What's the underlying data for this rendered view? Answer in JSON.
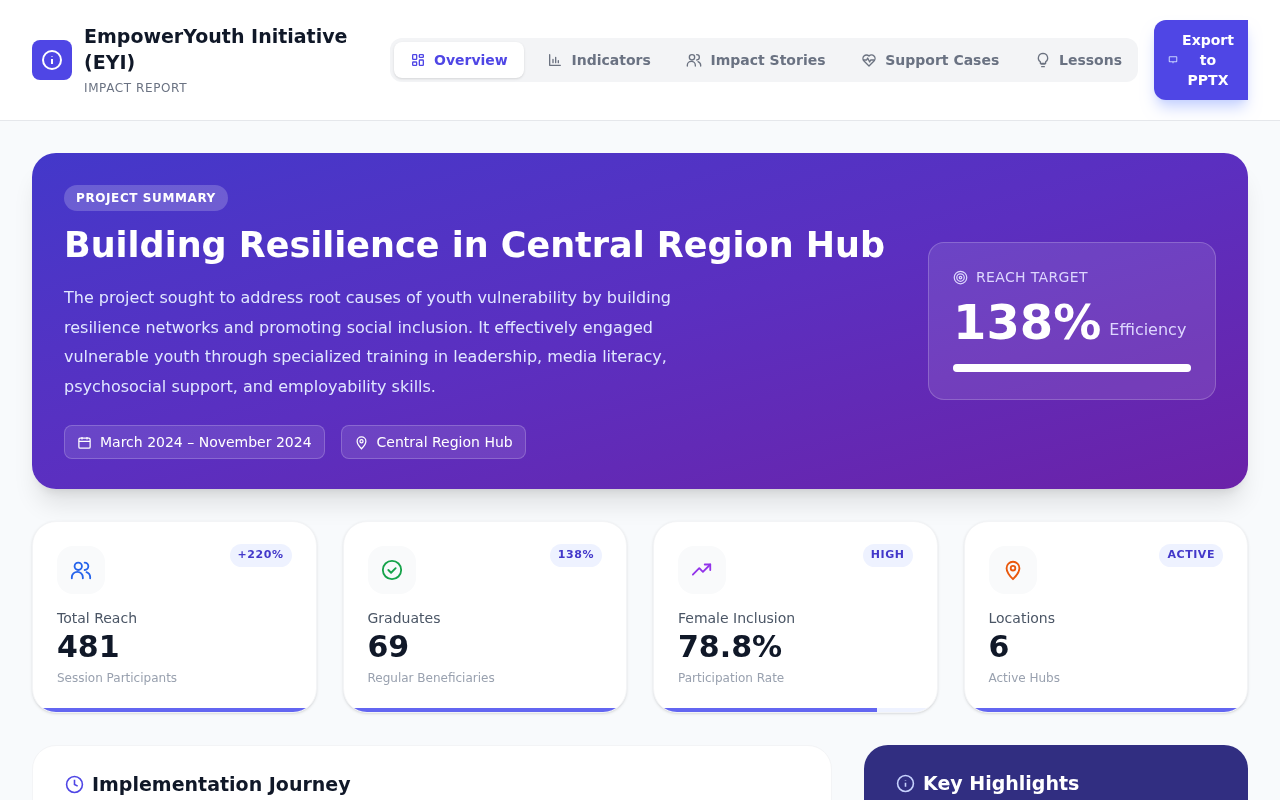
{
  "brand": {
    "title": "EmpowerYouth Initiative (EYI)",
    "subtitle": "IMPACT REPORT"
  },
  "tabs": [
    {
      "label": "Overview",
      "selected": true
    },
    {
      "label": "Indicators",
      "selected": false
    },
    {
      "label": "Impact Stories",
      "selected": false
    },
    {
      "label": "Support Cases",
      "selected": false
    },
    {
      "label": "Lessons",
      "selected": false
    }
  ],
  "export_button": "Export to PPTX",
  "hero": {
    "badge": "PROJECT SUMMARY",
    "title": "Building Resilience in Central Region Hub",
    "description": "The project sought to address root causes of youth vulnerability by building resilience networks and promoting social inclusion. It effectively engaged vulnerable youth through specialized training in leadership, media literacy, psychosocial support, and employability skills.",
    "dates": "March 2024 – November 2024",
    "location": "Central Region Hub",
    "target": {
      "label": "REACH TARGET",
      "value": "138%",
      "unit": "Efficiency",
      "level": 1
    }
  },
  "stats": [
    {
      "color": "#2563eb",
      "badge": "+220%",
      "label": "Total Reach",
      "value": "481",
      "caption": "Session Participants",
      "level": 1
    },
    {
      "color": "#16a34a",
      "badge": "138%",
      "label": "Graduates",
      "value": "69",
      "caption": "Regular Beneficiaries",
      "level": 1
    },
    {
      "color": "#9333ea",
      "badge": "HIGH",
      "label": "Female Inclusion",
      "value": "78.8%",
      "caption": "Participation Rate",
      "level": 0.788
    },
    {
      "color": "#ea580c",
      "badge": "ACTIVE",
      "label": "Locations",
      "value": "6",
      "caption": "Active Hubs",
      "level": 1
    }
  ],
  "sections": [
    {
      "title": "Implementation Journey",
      "kind": "light"
    },
    {
      "title": "Key Highlights",
      "kind": "dark"
    }
  ]
}
